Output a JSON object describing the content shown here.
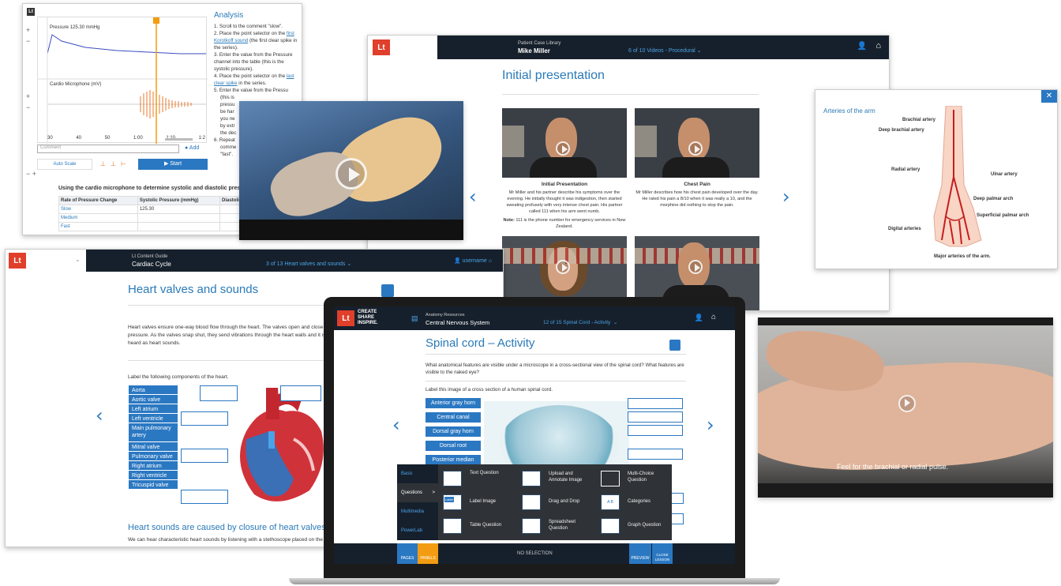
{
  "analysis": {
    "logo": "Lt",
    "pressure_label": "Pressure",
    "pressure_value": "125.30 mmHg",
    "cardio_label": "Cardio Microphone",
    "cardio_unit": "(mV)",
    "y1_ticks": [
      "200",
      "150",
      "100",
      "50",
      "0"
    ],
    "y2_ticks": [
      "60",
      "40",
      "20",
      "0",
      "-20",
      "-40",
      "-60"
    ],
    "x_ticks": [
      "30",
      "40",
      "50",
      "1:00",
      "1:10",
      "1:2"
    ],
    "comment_placeholder": "Comment",
    "add_label": "Add",
    "autoscale_label": "Auto Scale",
    "start_label": "▶ Start",
    "title": "Analysis",
    "steps": [
      {
        "n": "1.",
        "pre": "Scroll to the comment \"slow\".",
        "link": "",
        "post": ""
      },
      {
        "n": "2.",
        "pre": "Place the point selector on the ",
        "link": "first Korotkoff sound",
        "post": " (the first clear spike in the series)."
      },
      {
        "n": "3.",
        "pre": "Enter the value from the Pressure channel into the table (this is the systolic pressure).",
        "link": "",
        "post": ""
      },
      {
        "n": "4.",
        "pre": "Place the point selector on the ",
        "link": "last clear spike",
        "post": " in the series."
      },
      {
        "n": "5.",
        "pre": "Enter the value from the Pressu",
        "link": "",
        "post": ""
      }
    ],
    "step5_tail": [
      "(this is",
      "pressu",
      "be har",
      "you ne",
      "by extr",
      "the dec"
    ],
    "step6": {
      "n": "6.",
      "lines": [
        "Repeat",
        "comme",
        "\"fast\"."
      ]
    },
    "table_caption": "Using the cardio microphone to determine systolic and diastolic pressure:",
    "table_headers": [
      "Rate of Pressure Change",
      "Systolic Pressure (mmHg)",
      "Diastolic Pressure"
    ],
    "table_rows": [
      [
        "Slow",
        "125.30",
        ""
      ],
      [
        "Medium",
        "",
        ""
      ],
      [
        "Fast",
        "",
        ""
      ]
    ]
  },
  "patient": {
    "logo": "Lt",
    "library": "Patient Case Library",
    "patient_name": "Mike Miller",
    "tab_count": "6 of 10",
    "tab_label": "Videos - Procedural",
    "tab_caret": "⌄",
    "title": "Initial presentation",
    "videos": [
      {
        "title": "Initial Presentation",
        "text": "Mr Miller and his partner describe his symptoms over the evening. He initially thought it was indigestion, then started sweating profusely with very intense chest pain. His partner called 111 when his arm went numb.",
        "note_label": "Note:",
        "note": " 111 is the phone number for emergency services in New Zealand."
      },
      {
        "title": "Chest Pain",
        "text": "Mr Miller describes how his chest pain developed over the day. He rated his pain a 8/10 when it was really a 10, and the morphine did nothing to stop the pain.",
        "note_label": "",
        "note": ""
      }
    ],
    "prev_arrow": "‹",
    "next_arrow": "›"
  },
  "arteries": {
    "title": "Arteries of the arm",
    "close": "✕",
    "labels": [
      "Brachial artery",
      "Deep brachial artery",
      "Radial artery",
      "Ulnar artery",
      "Deep palmar arch",
      "Superficial palmar arch",
      "Digital arteries"
    ],
    "caption": "Major arteries of the arm."
  },
  "heart": {
    "logo": "Lt",
    "guide": "Lt Content Guide",
    "topic": "Cardiac Cycle",
    "tab_count": "3 of 13",
    "tab_label": "Heart valves and sounds",
    "tab_caret": "⌄",
    "username": "username",
    "title": "Heart valves and sounds",
    "para": "Heart valves ensure one-way blood flow through the heart. The valves open and close in",
    "para2": "pressure. As the valves snap shut, they send vibrations through the heart walls and it is t",
    "para3": "heard as heart sounds.",
    "instruction": "Label the following components of the heart.",
    "labels": [
      "Aorta",
      "Aortic valve",
      "Left atrium",
      "Left ventricle",
      "Main pulmonary artery",
      "Mitral valve",
      "Pulmonary valve",
      "Right atrium",
      "Right ventricle",
      "Tricuspid valve"
    ],
    "subheading": "Heart sounds are caused by closure of heart valves",
    "footer_text": "We can hear characteristic heart sounds by listening with a stethoscope placed on the ch",
    "prev_arrow": "‹"
  },
  "spinal": {
    "logo": "Lt",
    "brand": [
      "CREATE",
      "SHARE",
      "INSPIRE."
    ],
    "resources": "Anatomy Resources",
    "section": "Central Nervous System",
    "tab_label": "12 of 15 Spinal Cord - Activity",
    "tab_caret": "⌄",
    "title": "Spinal cord – Activity",
    "question": "What anatomical features are visible under a microscope in a cross-sectional view of the spinal cord? What features are visible to the naked eye?",
    "instruction": "Label this image of a cross section of a human spinal cord.",
    "labels": [
      "Anterior gray horn",
      "Central canal",
      "Dorsal gray horn",
      "Dorsal root",
      "Posterior median sulcus"
    ],
    "menu_items": [
      "Basic",
      "Questions",
      "Multimedia",
      "PowerLab"
    ],
    "menu_chevron": ">",
    "question_types": [
      "Text Question",
      "Upload and Annotate Image",
      "Multi-Choice Question",
      "Label Image",
      "Drag and Drop",
      "Categories",
      "Table Question",
      "Spreadsheet Question",
      "Graph Question"
    ],
    "icon_label_text": "Label",
    "icon_ab": [
      "A",
      "B"
    ],
    "pages_label": "PAGES",
    "panels_label": "PANELS",
    "no_selection": "NO SELECTION",
    "preview_label": "PREVIEW",
    "close_label": "CLOSE LESSON",
    "prev_arrow": "‹",
    "next_arrow": "›"
  },
  "pulse": {
    "caption": "Feel for the brachial or radial pulse."
  },
  "colors": {
    "brand_red": "#e03f2b",
    "navy": "#16202c",
    "accent_blue": "#2b78c2",
    "orange": "#f39c12"
  }
}
